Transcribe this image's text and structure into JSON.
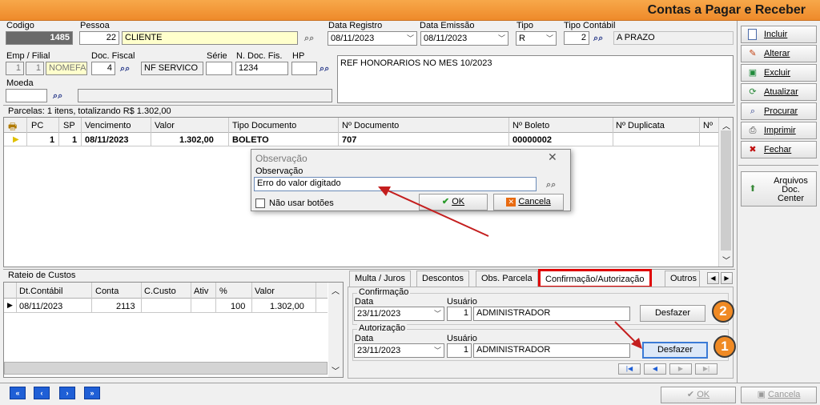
{
  "window": {
    "title": "Contas a Pagar e Receber"
  },
  "header": {
    "codigo_label": "Codigo",
    "codigo_value": "1485",
    "pessoa_label": "Pessoa",
    "pessoa_code": "22",
    "pessoa_name": "CLIENTE",
    "data_registro_label": "Data Registro",
    "data_registro_value": "08/11/2023",
    "data_emissao_label": "Data Emissão",
    "data_emissao_value": "08/11/2023",
    "tipo_label": "Tipo",
    "tipo_value": "R",
    "tipo_contabil_label": "Tipo Contábil",
    "tipo_contabil_code": "2",
    "tipo_contabil_name": "A PRAZO",
    "emp_filial_label": "Emp / Filial",
    "emp_value": "1",
    "filial_value": "1",
    "emp_name": "NOMEFA",
    "doc_fiscal_label": "Doc. Fiscal",
    "doc_fiscal_code": "4",
    "doc_fiscal_name": "NF SERVICO",
    "serie_label": "Série",
    "serie_value": "",
    "n_doc_fis_label": "N. Doc. Fis.",
    "n_doc_fis_value": "1234",
    "hp_label": "HP",
    "hp_value": "",
    "observacao_text": "REF HONORARIOS NO MES 10/2023",
    "moeda_label": "Moeda",
    "moeda_value": ""
  },
  "sidebar": {
    "incluir": "Incluir",
    "alterar": "Alterar",
    "excluir": "Excluir",
    "atualizar": "Atualizar",
    "procurar": "Procurar",
    "imprimir": "Imprimir",
    "fechar": "Fechar",
    "arquivos_l1": "Arquivos",
    "arquivos_l2": "Doc.",
    "arquivos_l3": "Center"
  },
  "parcelas": {
    "summary": "Parcelas: 1 itens, totalizando R$ 1.302,00",
    "columns": [
      "PC",
      "SP",
      "Vencimento",
      "Valor",
      "Tipo Documento",
      "Nº Documento",
      "Nº Boleto",
      "Nº Duplicata",
      "Nº"
    ],
    "row": {
      "pc": "1",
      "sp": "1",
      "vencimento": "08/11/2023",
      "valor": "1.302,00",
      "tipo_documento": "BOLETO",
      "n_documento": "707",
      "n_boleto": "00000002",
      "n_duplicata": ""
    }
  },
  "dialog": {
    "title": "Observação",
    "field_label": "Observação",
    "field_value": "Erro do valor digitado",
    "checkbox_label": "Não usar botões",
    "ok_label": "OK",
    "cancel_label": "Cancela"
  },
  "rateio": {
    "title": "Rateio de Custos",
    "columns": [
      "Dt.Contábil",
      "Conta",
      "C.Custo",
      "Ativ",
      "%",
      "Valor"
    ],
    "row": {
      "dt_contabil": "08/11/2023",
      "conta": "2113",
      "c_custo": "",
      "ativ": "",
      "percent": "100",
      "valor": "1.302,00"
    }
  },
  "tabs": {
    "multa": "Multa / Juros",
    "descontos": "Descontos",
    "obs_parcela": "Obs. Parcela",
    "confirmacao": "Confirmação/Autorização",
    "outros": "Outros"
  },
  "confirmacao": {
    "group_label": "Confirmação",
    "data_label": "Data",
    "usuario_label": "Usuário",
    "data_value": "23/11/2023",
    "usuario_code": "1",
    "usuario_name": "ADMINISTRADOR",
    "desfazer": "Desfazer",
    "badge": "2"
  },
  "autorizacao": {
    "group_label": "Autorização",
    "data_label": "Data",
    "usuario_label": "Usuário",
    "data_value": "23/11/2023",
    "usuario_code": "1",
    "usuario_name": "ADMINISTRADOR",
    "desfazer": "Desfazer",
    "badge": "1"
  },
  "footer": {
    "ok_label": "OK",
    "cancel_label": "Cancela"
  },
  "colors": {
    "accent_orange": "#f08a24",
    "highlight_red": "#e00000",
    "arrow_red": "#c41e1e",
    "nav_blue": "#1f5fd6"
  }
}
